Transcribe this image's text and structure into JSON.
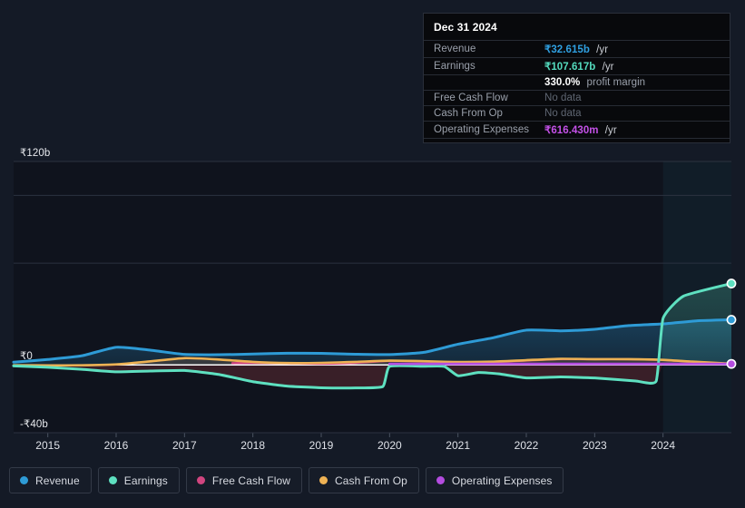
{
  "tooltip": {
    "date": "Dec 31 2024",
    "rows": [
      {
        "key": "Revenue",
        "value": "₹32.615b",
        "unit": "/yr",
        "style": "revenue"
      },
      {
        "key": "Earnings",
        "value": "₹107.617b",
        "unit": "/yr",
        "style": "earnings"
      },
      {
        "key": "",
        "value": "330.0%",
        "unit": "profit margin",
        "style": "margin"
      },
      {
        "key": "Free Cash Flow",
        "value": "No data",
        "unit": "",
        "style": "nodata"
      },
      {
        "key": "Cash From Op",
        "value": "No data",
        "unit": "",
        "style": "nodata"
      },
      {
        "key": "Operating Expenses",
        "value": "₹616.430m",
        "unit": "/yr",
        "style": "opex"
      }
    ]
  },
  "legend": {
    "items": [
      {
        "label": "Revenue",
        "color": "#2e9bd6"
      },
      {
        "label": "Earnings",
        "color": "#5ee0c0"
      },
      {
        "label": "Free Cash Flow",
        "color": "#d1457f"
      },
      {
        "label": "Cash From Op",
        "color": "#eeb254"
      },
      {
        "label": "Operating Expenses",
        "color": "#b44ce0"
      }
    ]
  },
  "chart_data": {
    "type": "area",
    "title": "",
    "xlabel": "",
    "ylabel": "",
    "currency": "₹",
    "ylim": [
      -40,
      120
    ],
    "y_ticks": [
      {
        "label": "₹120b",
        "value": 120
      },
      {
        "label": "₹0",
        "value": 0
      },
      {
        "label": "-₹40b",
        "value": -40
      }
    ],
    "gridlines": [
      120,
      100,
      60,
      0,
      -40
    ],
    "x_ticks": [
      "2015",
      "2016",
      "2017",
      "2018",
      "2019",
      "2020",
      "2021",
      "2022",
      "2023",
      "2024"
    ],
    "x_range": [
      2014.5,
      2025.0
    ],
    "grid": true,
    "legend_position": "bottom",
    "highlight_band": {
      "from": 2024.0,
      "to": 2025.0
    },
    "series": [
      {
        "name": "Revenue",
        "color": "#2e9bd6",
        "x": [
          2014.5,
          2015.0,
          2015.5,
          2016.0,
          2016.5,
          2017.0,
          2017.5,
          2018.0,
          2018.5,
          2019.0,
          2019.5,
          2020.0,
          2020.5,
          2021.0,
          2021.5,
          2022.0,
          2022.5,
          2023.0,
          2023.5,
          2024.0,
          2024.5,
          2025.0
        ],
        "values": [
          1.6,
          3.2,
          5.4,
          10.4,
          8.7,
          6.2,
          6.0,
          6.4,
          6.9,
          6.8,
          6.3,
          6.1,
          7.4,
          12.2,
          15.9,
          20.5,
          20.1,
          21.0,
          23.2,
          24.2,
          26.0,
          26.6
        ],
        "end_marker": true
      },
      {
        "name": "Earnings",
        "color": "#5ee0c0",
        "x": [
          2014.5,
          2015.0,
          2015.5,
          2016.0,
          2016.5,
          2017.0,
          2017.5,
          2018.0,
          2018.5,
          2019.0,
          2019.5,
          2019.9,
          2020.0,
          2020.5,
          2020.8,
          2021.0,
          2021.3,
          2021.6,
          2022.0,
          2022.5,
          2023.0,
          2023.6,
          2023.9,
          2024.0,
          2024.3,
          2025.0
        ],
        "values": [
          -0.6,
          -1.4,
          -2.6,
          -4.1,
          -3.6,
          -3.3,
          -5.6,
          -9.9,
          -12.5,
          -13.5,
          -13.6,
          -12.8,
          -0.9,
          -0.8,
          -0.9,
          -6.4,
          -4.5,
          -5.3,
          -7.7,
          -7.1,
          -7.7,
          -9.5,
          -9.6,
          27.4,
          40.6,
          48.0
        ],
        "end_marker": true
      },
      {
        "name": "Free Cash Flow",
        "color": "#d1457f",
        "x": [
          2017.7,
          2018.0,
          2018.5,
          2019.0,
          2019.5,
          2020.0,
          2020.5,
          2021.0,
          2021.5,
          2022.0,
          2022.5,
          2023.0,
          2023.5,
          2024.0,
          2024.4,
          2025.0
        ],
        "values": [
          1.0,
          1.2,
          1.0,
          0.7,
          1.2,
          2.4,
          2.1,
          1.6,
          1.7,
          2.6,
          3.4,
          3.3,
          3.3,
          2.9,
          1.9,
          0.6
        ]
      },
      {
        "name": "Cash From Op",
        "color": "#eeb254",
        "x": [
          2014.5,
          2015.0,
          2015.5,
          2016.0,
          2016.5,
          2017.0,
          2017.5,
          2018.0,
          2018.5,
          2019.0,
          2019.5,
          2020.0,
          2020.5,
          2021.0,
          2021.5,
          2022.0,
          2022.5,
          2023.0,
          2023.5,
          2024.0,
          2024.4,
          2025.0
        ],
        "values": [
          -0.2,
          -0.3,
          -0.2,
          0.3,
          2.1,
          4.0,
          3.2,
          1.8,
          1.1,
          1.2,
          1.8,
          2.5,
          2.2,
          1.7,
          1.9,
          2.8,
          3.6,
          3.4,
          3.4,
          3.0,
          2.0,
          0.7
        ]
      },
      {
        "name": "Operating Expenses",
        "color": "#b44ce0",
        "x": [
          2020.0,
          2021.0,
          2022.0,
          2023.0,
          2024.0,
          2025.0
        ],
        "values": [
          0.6,
          0.6,
          0.6,
          0.6,
          0.6,
          0.6
        ],
        "end_marker": true
      }
    ]
  }
}
